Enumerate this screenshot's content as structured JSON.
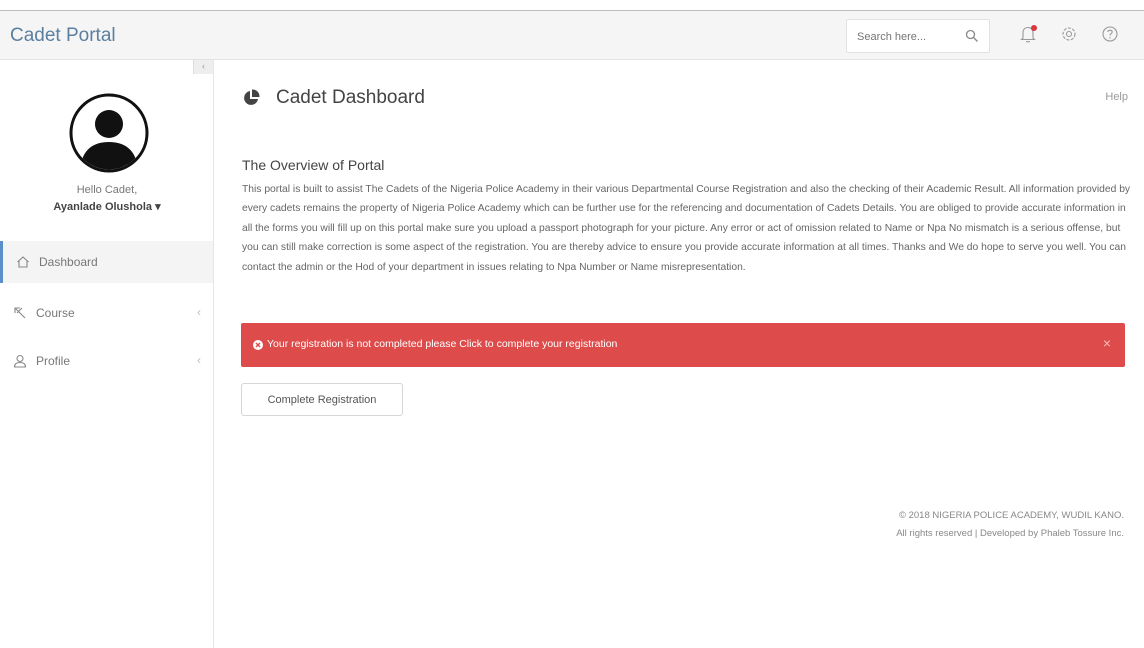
{
  "header": {
    "brand": "Cadet Portal",
    "search_placeholder": "Search here..."
  },
  "sidebar": {
    "greeting": "Hello Cadet,",
    "user_name": "Ayanlade Olushola ▾",
    "items": [
      {
        "label": "Dashboard",
        "icon": "home-icon",
        "active": true
      },
      {
        "label": "Course",
        "icon": "tools-icon",
        "active": false
      },
      {
        "label": "Profile",
        "icon": "user-icon",
        "active": false
      }
    ],
    "chevron": "‹"
  },
  "main": {
    "title": "Cadet Dashboard",
    "help_link": "Help",
    "overview_title": "The Overview of Portal",
    "overview_text": "This portal is built to assist The Cadets of the Nigeria Police Academy in their various Departmental Course Registration and also the checking of their Academic Result. All information provided by every cadets remains the property of Nigeria Police Academy which can be further use for the referencing and documentation of Cadets Details. You are obliged to provide accurate information in all the forms you will fill up on this portal make sure you upload a passport photograph for your picture. Any error or act of omission related to Name or Npa No mismatch is a serious offense, but you can still make correction is some aspect of the registration. You are thereby advice to ensure you provide accurate information at all times. Thanks and We do hope to serve you well. You can contact the admin or the Hod of your department in issues relating to Npa Number or Name misrepresentation.",
    "alert_text": "Your registration is not completed please Click to complete your registration",
    "alert_close": "×",
    "button_label": "Complete Registration"
  },
  "footer": {
    "line1": "© 2018 NIGERIA POLICE ACADEMY, WUDIL KANO.",
    "line2": "All rights reserved | Developed by Phaleb Tossure Inc."
  },
  "colors": {
    "brand": "#5a7fa0",
    "alert": "#de4b4b",
    "active_border": "#5a8fc8"
  }
}
